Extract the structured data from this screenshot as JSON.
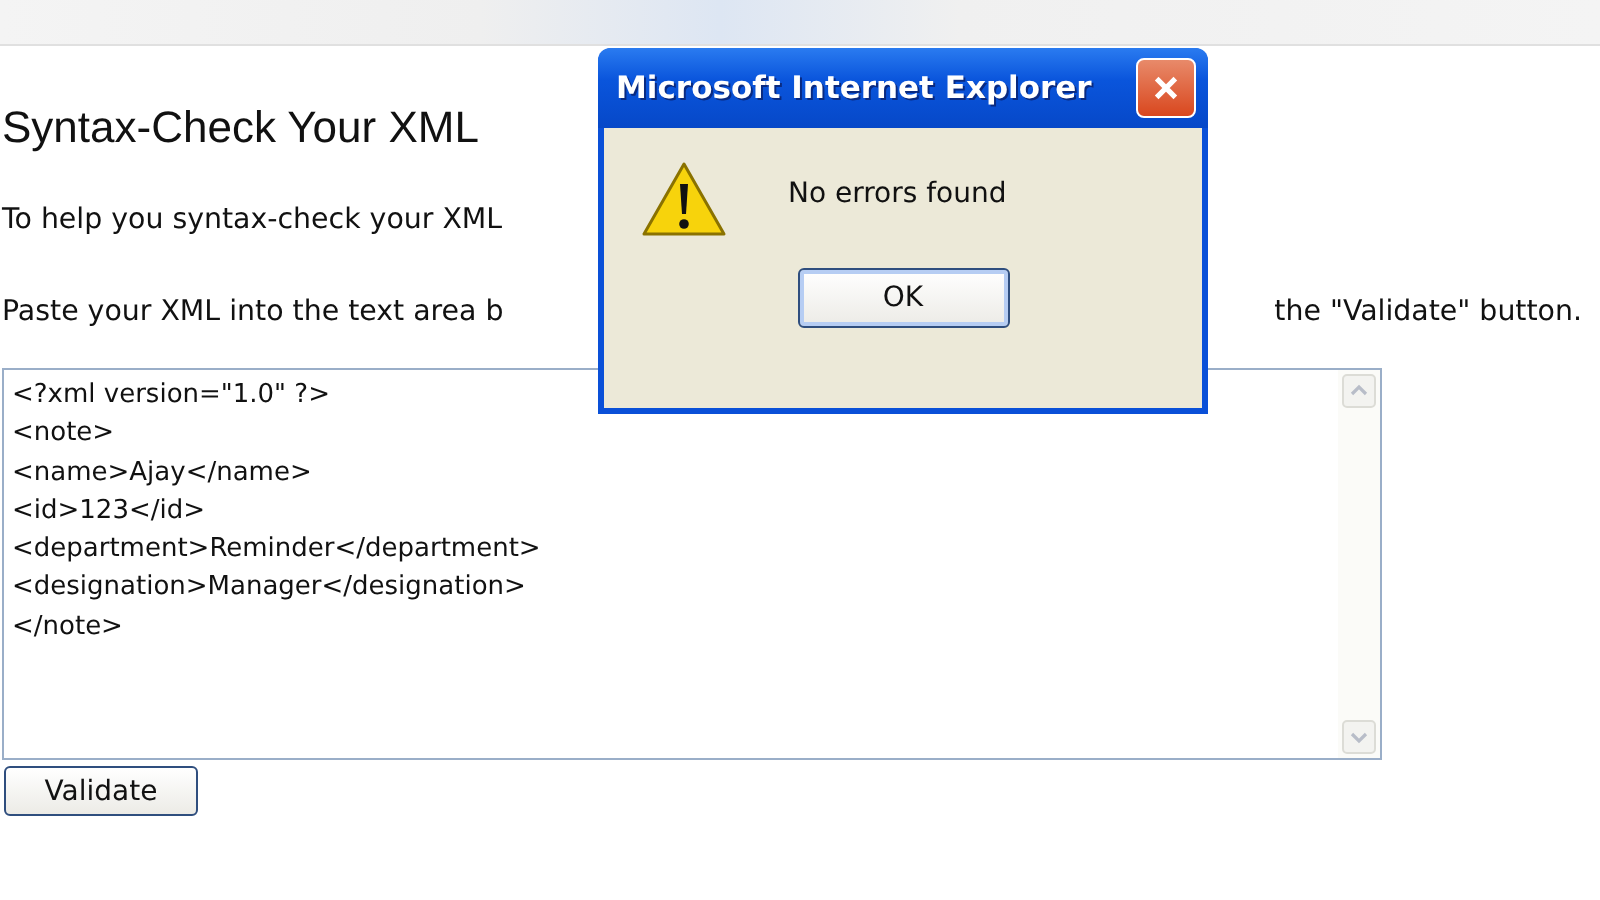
{
  "page": {
    "heading": "Syntax-Check Your XML",
    "paragraphs": [
      {
        "text": "To help you syntax-check your XML"
      },
      {
        "text": "Paste your XML into the text area b",
        "text_after": "the \"Validate\" button."
      }
    ]
  },
  "editor": {
    "lines": [
      "<?xml version=\"1.0\" ?>",
      "<note>",
      "<name>Ajay</name>",
      "<id>123</id>",
      "<department>Reminder</department>",
      "<designation>Manager</designation>",
      "</note>"
    ]
  },
  "validate_button": "Validate",
  "dialog": {
    "title": "Microsoft Internet Explorer",
    "message": "No errors found",
    "button": "OK"
  }
}
